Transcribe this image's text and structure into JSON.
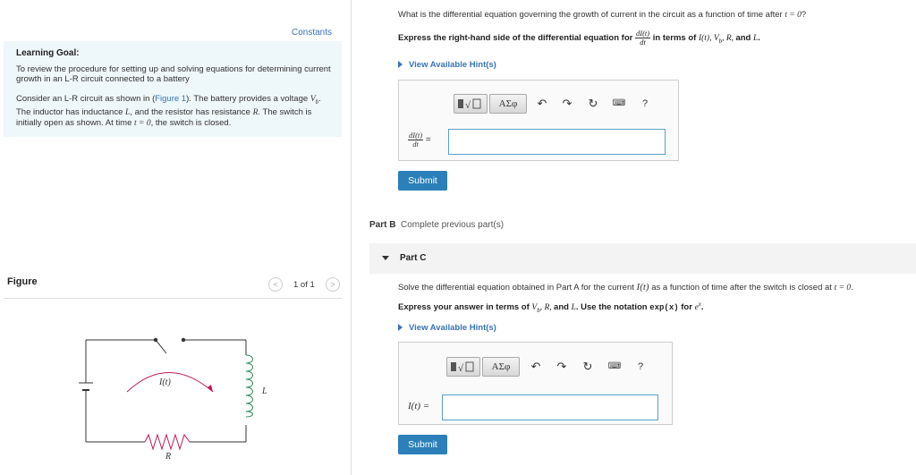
{
  "left": {
    "constants_link": "Constants",
    "learning_goal": {
      "title": "Learning Goal:",
      "text": "To review the procedure for setting up and solving equations for determining current growth in an L-R circuit connected to a battery",
      "consider_1": "Consider an L-R circuit as shown in (",
      "figure_link": "Figure 1",
      "consider_2": "). The battery provides a voltage ",
      "vb": "V",
      "vb_sub": "b",
      "consider_3": ". The inductor has inductance ",
      "L": "L",
      "consider_4": ", and the resistor has resistance ",
      "R": "R",
      "consider_5": ". The switch is initially open as shown. At time ",
      "t0": "t = 0",
      "consider_6": ", the switch is closed."
    },
    "figure": {
      "label": "Figure",
      "count": "1 of 1",
      "prev": "<",
      "next": ">",
      "circuit_labels": {
        "current": "I(t)",
        "inductor": "L",
        "resistor": "R"
      }
    }
  },
  "partA": {
    "question_1": "What is the differential equation governing the growth of current in the circuit as a function of time after ",
    "question_t": "t = 0",
    "question_2": "?",
    "express_1": "Express the right-hand side of the differential equation for ",
    "frac_num": "dI(t)",
    "frac_den": "dt",
    "express_2": " in terms of ",
    "express_vars": "I(t), V",
    "express_vars_sub": "b",
    "express_vars2": ", R, ",
    "express_and": "and ",
    "express_L": "L",
    "express_end": ".",
    "hints": "View Available Hint(s)",
    "lhs_num": "dI(t)",
    "lhs_den": "dt",
    "lhs_eq": "=",
    "input_value": "",
    "submit": "Submit"
  },
  "toolbar": {
    "template_icon": "template-icon",
    "greek": "ΑΣφ",
    "undo": "undo-icon",
    "redo": "redo-icon",
    "reset": "reset-icon",
    "keyboard": "keyboard-icon",
    "help": "?"
  },
  "partB": {
    "label": "Part B",
    "status": "Complete previous part(s)"
  },
  "partC": {
    "label": "Part C",
    "question_1": "Solve the differential equation obtained in Part A for the current ",
    "question_I": "I(t)",
    "question_2": " as a function of time after the switch is closed at ",
    "question_t": "t = 0",
    "question_3": ".",
    "express_1": "Express your answer in terms of ",
    "express_vars": "V",
    "express_sub": "b",
    "express_vars2": ", R, ",
    "express_and": "and ",
    "express_L": "L",
    "express_2": ". Use the notation ",
    "express_code": "exp(x)",
    "express_3": " for ",
    "express_e": "e",
    "express_esup": "x",
    "express_4": ".",
    "hints": "View Available Hint(s)",
    "lhs": "I(t) =",
    "input_value": "",
    "submit": "Submit"
  },
  "colors": {
    "link": "#3873b8",
    "submit": "#2c7fb8",
    "goal_bg": "#eef7fa",
    "input_border": "#5aa0c9",
    "arrow": "#c2185b"
  }
}
